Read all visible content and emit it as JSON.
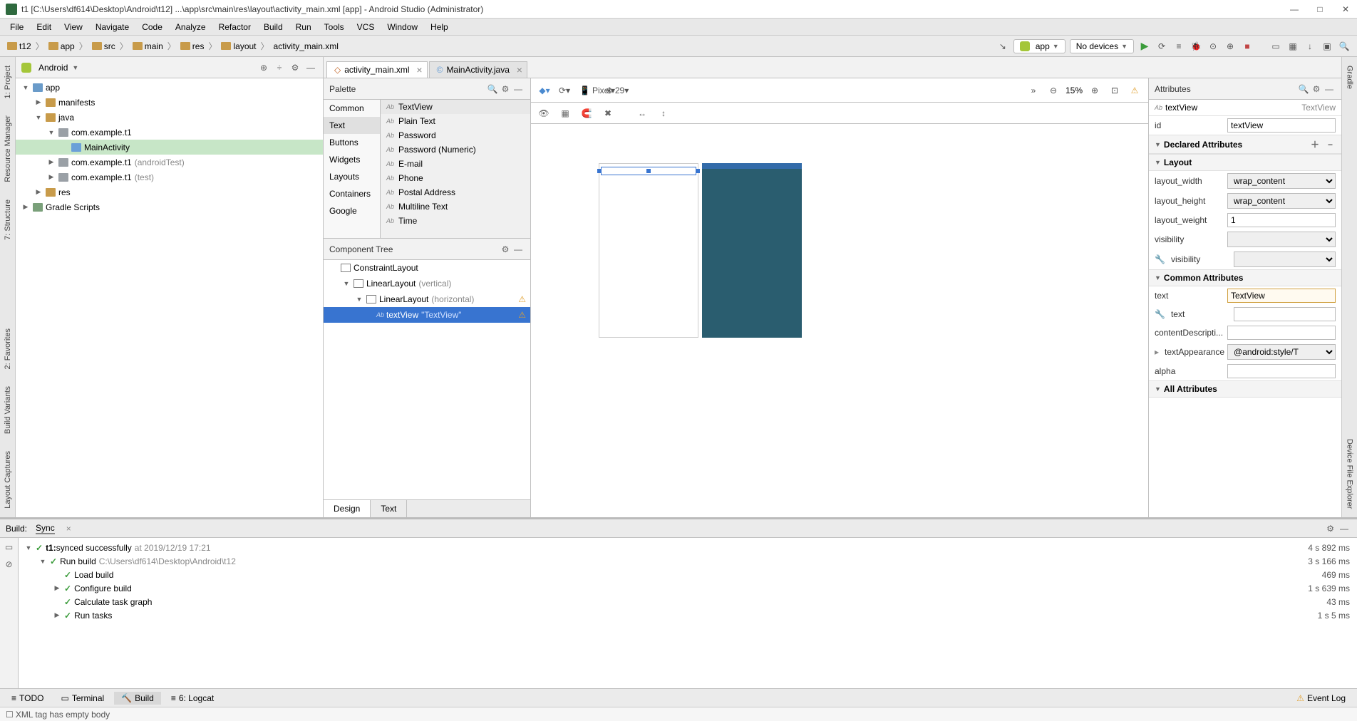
{
  "window": {
    "title": "t1 [C:\\Users\\df614\\Desktop\\Android\\t12]  ...\\app\\src\\main\\res\\layout\\activity_main.xml [app] - Android Studio (Administrator)"
  },
  "menu": [
    "File",
    "Edit",
    "View",
    "Navigate",
    "Code",
    "Analyze",
    "Refactor",
    "Build",
    "Run",
    "Tools",
    "VCS",
    "Window",
    "Help"
  ],
  "breadcrumbs": [
    "t12",
    "app",
    "src",
    "main",
    "res",
    "layout",
    "activity_main.xml"
  ],
  "runconfig": {
    "module": "app",
    "devices": "No devices"
  },
  "project": {
    "headerLabel": "Android",
    "nodes": [
      {
        "indent": 0,
        "tog": "▼",
        "ico": "ico-mod",
        "label": "app"
      },
      {
        "indent": 1,
        "tog": "▶",
        "ico": "ico-fold",
        "label": "manifests"
      },
      {
        "indent": 1,
        "tog": "▼",
        "ico": "ico-fold",
        "label": "java"
      },
      {
        "indent": 2,
        "tog": "▼",
        "ico": "ico-pkg",
        "label": "com.example.t1"
      },
      {
        "indent": 3,
        "tog": "",
        "ico": "ico-cls",
        "label": "MainActivity",
        "sel": true
      },
      {
        "indent": 2,
        "tog": "▶",
        "ico": "ico-pkg",
        "label": "com.example.t1",
        "dim": "(androidTest)"
      },
      {
        "indent": 2,
        "tog": "▶",
        "ico": "ico-pkg",
        "label": "com.example.t1",
        "dim": "(test)"
      },
      {
        "indent": 1,
        "tog": "▶",
        "ico": "ico-fold",
        "label": "res"
      },
      {
        "indent": 0,
        "tog": "▶",
        "ico": "ico-grd",
        "label": "Gradle Scripts"
      }
    ]
  },
  "editorTabs": [
    {
      "label": "activity_main.xml",
      "active": true,
      "icon": "xml"
    },
    {
      "label": "MainActivity.java",
      "active": false,
      "icon": "cls"
    }
  ],
  "palette": {
    "header": "Palette",
    "categories": [
      "Common",
      "Text",
      "Buttons",
      "Widgets",
      "Layouts",
      "Containers",
      "Google"
    ],
    "activeCat": "Text",
    "items": [
      "TextView",
      "Plain Text",
      "Password",
      "Password (Numeric)",
      "E-mail",
      "Phone",
      "Postal Address",
      "Multiline Text",
      "Time"
    ],
    "selItem": "TextView"
  },
  "componentTree": {
    "header": "Component Tree",
    "nodes": [
      {
        "indent": 0,
        "tog": "",
        "label": "ConstraintLayout"
      },
      {
        "indent": 1,
        "tog": "▼",
        "label": "LinearLayout",
        "dim": "(vertical)"
      },
      {
        "indent": 2,
        "tog": "▼",
        "label": "LinearLayout",
        "dim": "(horizontal)",
        "warn": true
      },
      {
        "indent": 3,
        "tog": "",
        "label": "textView",
        "dim": "\"TextView\"",
        "sel": true,
        "warn": true,
        "pre": "Ab"
      }
    ]
  },
  "preview": {
    "device": "Pixel",
    "api": "29",
    "zoom": "15%"
  },
  "designTabs": {
    "design": "Design",
    "text": "Text"
  },
  "attributes": {
    "header": "Attributes",
    "selName": "textView",
    "selClass": "TextView",
    "id": {
      "label": "id",
      "value": "textView"
    },
    "sections": {
      "declared": "Declared Attributes",
      "layout": "Layout",
      "common": "Common Attributes",
      "all": "All Attributes"
    },
    "rows": {
      "layout_width": {
        "label": "layout_width",
        "value": "wrap_content"
      },
      "layout_height": {
        "label": "layout_height",
        "value": "wrap_content"
      },
      "layout_weight": {
        "label": "layout_weight",
        "value": "1"
      },
      "visibility": {
        "label": "visibility",
        "value": ""
      },
      "tools_visibility": {
        "label": "visibility",
        "value": ""
      },
      "text": {
        "label": "text",
        "value": "TextView"
      },
      "tools_text": {
        "label": "text",
        "value": ""
      },
      "contentDesc": {
        "label": "contentDescripti...",
        "value": ""
      },
      "textAppearance": {
        "label": "textAppearance",
        "placeholder": "@android:style/T"
      },
      "alpha": {
        "label": "alpha",
        "value": ""
      }
    }
  },
  "build": {
    "tab1": "Build:",
    "tab2": "Sync",
    "nodes": [
      {
        "indent": 0,
        "tog": "▼",
        "bold": "t1:",
        "label": " synced successfully",
        "dim": "at 2019/12/19 17:21",
        "time": "4 s 892 ms"
      },
      {
        "indent": 1,
        "tog": "▼",
        "label": "Run build",
        "dim": "C:\\Users\\df614\\Desktop\\Android\\t12",
        "time": "3 s 166 ms"
      },
      {
        "indent": 2,
        "tog": "",
        "label": "Load build",
        "time": "469 ms"
      },
      {
        "indent": 2,
        "tog": "▶",
        "label": "Configure build",
        "time": "1 s 639 ms"
      },
      {
        "indent": 2,
        "tog": "",
        "label": "Calculate task graph",
        "time": "43 ms"
      },
      {
        "indent": 2,
        "tog": "▶",
        "label": "Run tasks",
        "time": "1 s 5 ms"
      }
    ]
  },
  "bottomTools": {
    "todo": "TODO",
    "terminal": "Terminal",
    "build": "Build",
    "logcat": "6: Logcat",
    "eventlog": "Event Log"
  },
  "status": "XML tag has empty body",
  "leftTools": [
    "1: Project",
    "7: Structure",
    "2: Favorites",
    "Build Variants",
    "Layout Captures",
    "Resource Manager"
  ],
  "rightTools": [
    "Gradle",
    "Device File Explorer"
  ]
}
